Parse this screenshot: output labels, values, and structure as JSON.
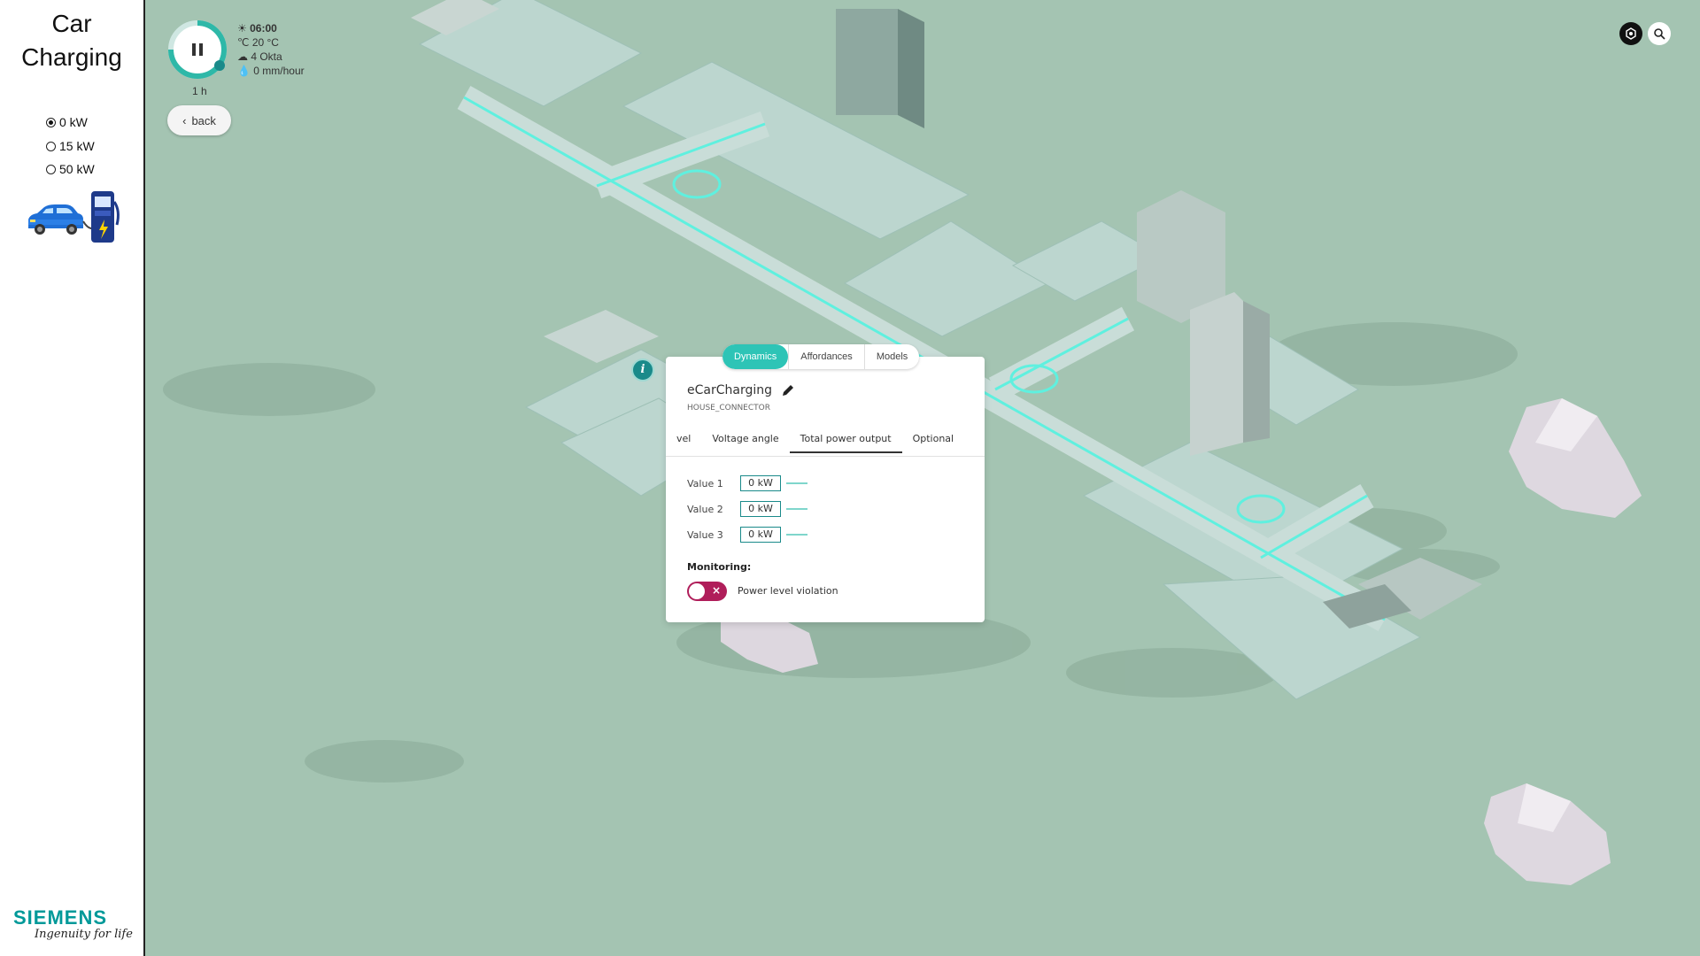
{
  "sidebar": {
    "title": "Car\nCharging",
    "options": [
      {
        "label": "0 kW",
        "checked": true
      },
      {
        "label": "15 kW",
        "checked": false
      },
      {
        "label": "50 kW",
        "checked": false
      }
    ],
    "logo": {
      "brand": "SIEMENS",
      "tagline": "Ingenuity for life"
    }
  },
  "playback": {
    "step_label": "1 h",
    "weather": {
      "time": "06:00",
      "temperature": "20 °C",
      "cloud": "4 Okta",
      "rain": "0 mm/hour"
    }
  },
  "nav": {
    "back_label": "back"
  },
  "dialog": {
    "top_tabs": [
      {
        "label": "Dynamics",
        "active": true
      },
      {
        "label": "Affordances",
        "active": false
      },
      {
        "label": "Models",
        "active": false
      }
    ],
    "title": "eCarCharging",
    "subtitle": "HOUSE_CONNECTOR",
    "sub_tabs": [
      {
        "label": "vel",
        "active": false
      },
      {
        "label": "Voltage angle",
        "active": false
      },
      {
        "label": "Total power output",
        "active": true
      },
      {
        "label": "Optional",
        "active": false
      }
    ],
    "values": [
      {
        "label": "Value 1",
        "value": "0 kW"
      },
      {
        "label": "Value 2",
        "value": "0 kW"
      },
      {
        "label": "Value 3",
        "value": "0 kW"
      }
    ],
    "monitoring": {
      "title": "Monitoring:",
      "toggle_label": "Power level violation",
      "enabled": false
    }
  },
  "colors": {
    "map_bg": "#a4c4b2",
    "accent": "#2ec4b6",
    "teal_dark": "#1a8a8a",
    "toggle_off": "#b01e5a",
    "brand": "#009999"
  },
  "icons": [
    "pause-icon",
    "sun-icon",
    "thermometer-icon",
    "cloud-icon",
    "rain-icon",
    "chevron-left-icon",
    "settings-icon",
    "search-icon",
    "info-icon",
    "pencil-icon",
    "car-icon",
    "charging-station-icon"
  ]
}
